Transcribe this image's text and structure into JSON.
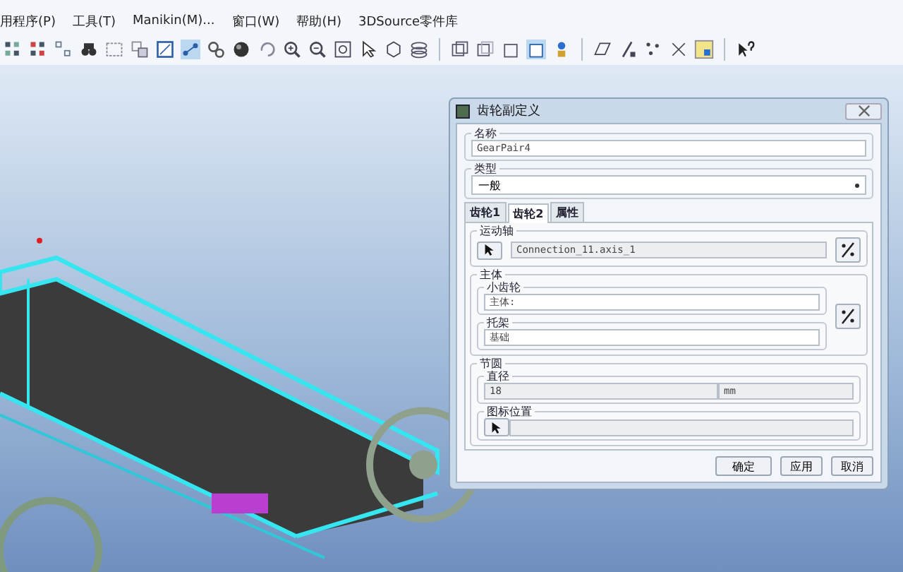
{
  "menu": [
    "用程序(P)",
    "工具(T)",
    "Manikin(M)...",
    "窗口(W)",
    "帮助(H)",
    "3DSource零件库"
  ],
  "dialog": {
    "title": "齿轮副定义",
    "name": {
      "label": "名称",
      "value": "GearPair4"
    },
    "type": {
      "label": "类型",
      "value": "一般"
    },
    "tabs": [
      {
        "label": "齿轮1",
        "selected": false
      },
      {
        "label": "齿轮2",
        "selected": true
      },
      {
        "label": "属性",
        "selected": false
      }
    ],
    "motion_axis": {
      "label": "运动轴",
      "value": "Connection_11.axis_1"
    },
    "body": {
      "label": "主体",
      "gear": {
        "label": "小齿轮",
        "value": "主体:"
      },
      "carrier": {
        "label": "托架",
        "value": "基础"
      }
    },
    "pitch_circle": {
      "label": "节圆",
      "diameter": {
        "label": "直径",
        "value": "18",
        "unit": "mm"
      },
      "icon_position": {
        "label": "图标位置"
      }
    },
    "buttons": [
      "确定",
      "应用",
      "取消"
    ]
  }
}
